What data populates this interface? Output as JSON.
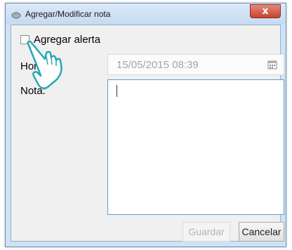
{
  "window": {
    "title": "Agregar/Modificar nota",
    "close_glyph": "x"
  },
  "form": {
    "alert_checkbox_label": "Agregar alerta",
    "alert_checked": false,
    "hora_label": "Hora",
    "hora_value": "15/05/2015 08:39",
    "nota_label": "Nota:",
    "nota_value": ""
  },
  "buttons": {
    "guardar": "Guardar",
    "cancelar": "Cancelar"
  },
  "icons": {
    "app": "note-app-icon",
    "close": "close-icon",
    "calendar": "calendar-icon",
    "pointer": "hand-pointer-icon"
  },
  "colors": {
    "title_bar": "#cfe2f5",
    "close_button": "#c7432e",
    "focus_border": "#5b9bd5",
    "pointer_outline": "#2aa7b4"
  }
}
